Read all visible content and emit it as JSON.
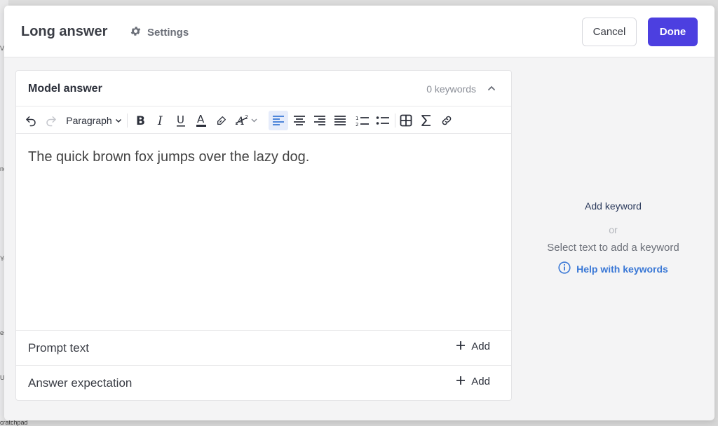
{
  "background": {
    "strip_texts": [
      "Va",
      "nc",
      "Yo",
      "es",
      "Uj"
    ],
    "scratchpad_label": "cratchpad"
  },
  "header": {
    "title": "Long answer",
    "settings_label": "Settings",
    "cancel_label": "Cancel",
    "done_label": "Done"
  },
  "card": {
    "title": "Model answer",
    "keywords_count": "0 keywords",
    "toolbar": {
      "paragraph_label": "Paragraph"
    },
    "body_text": "The quick brown fox jumps over the lazy dog.",
    "rows": [
      {
        "label": "Prompt text",
        "add_label": "Add"
      },
      {
        "label": "Answer expectation",
        "add_label": "Add"
      }
    ]
  },
  "side": {
    "add_keyword": "Add keyword",
    "or": "or",
    "select_text": "Select text to add a keyword",
    "help_link": "Help with keywords"
  },
  "colors": {
    "accent": "#4c3fe0",
    "link": "#3a78d6",
    "active_tool_bg": "#e6ecfb"
  }
}
